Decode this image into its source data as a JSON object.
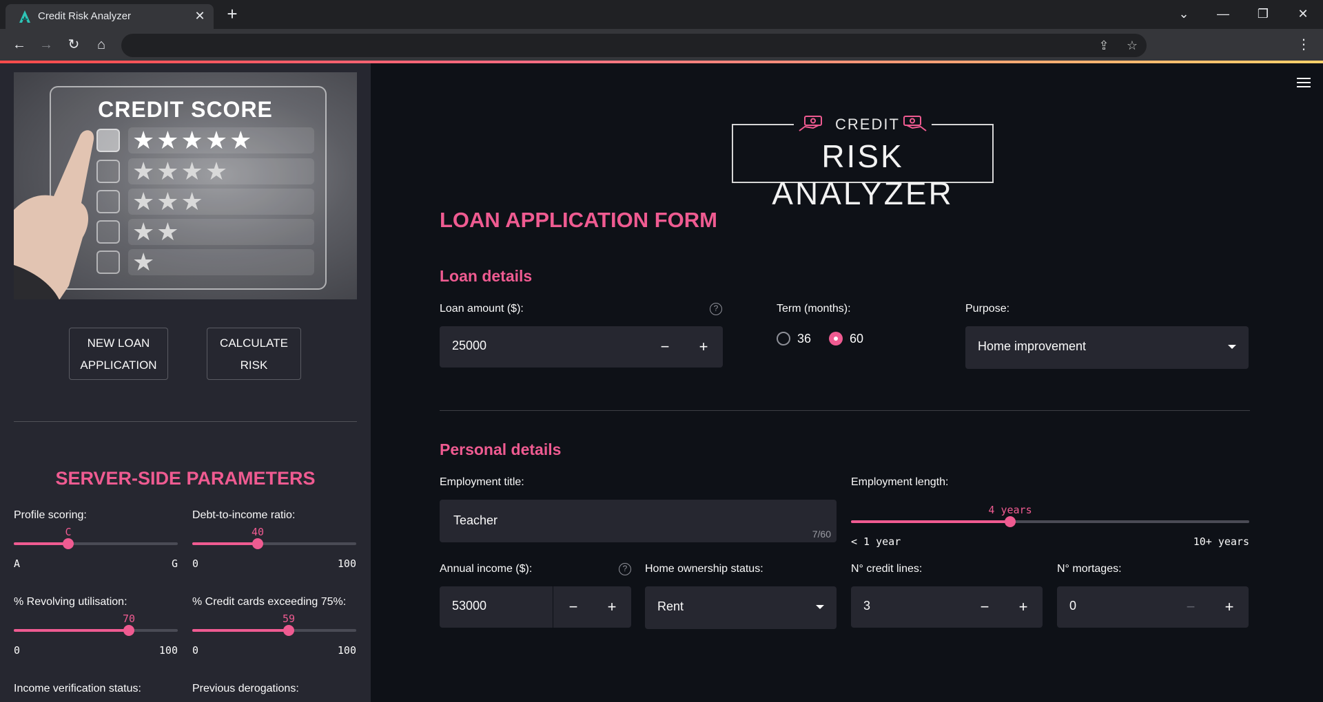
{
  "browser": {
    "tab_title": "Credit Risk Analyzer",
    "tab_close": "✕",
    "new_tab": "+",
    "window_controls": [
      "⌄",
      "—",
      "❐",
      "✕"
    ],
    "nav": {
      "back": "←",
      "forward": "→",
      "reload": "↻",
      "home": "⌂"
    },
    "omnibox_icons": [
      "share-icon",
      "star-icon"
    ],
    "menu": "⋮"
  },
  "sidebar": {
    "hero": {
      "title": "CREDIT SCORE",
      "rows": [
        "★★★★★",
        "★★★★",
        "★★★",
        "★★",
        "★"
      ]
    },
    "buttons": {
      "new_loan": [
        "NEW LOAN",
        "APPLICATION"
      ],
      "calculate": [
        "CALCULATE",
        "RISK"
      ]
    },
    "heading": "SERVER-SIDE PARAMETERS",
    "params": [
      {
        "label": "Profile scoring:",
        "value": "C",
        "min": "A",
        "max": "G",
        "fraction": 0.3333
      },
      {
        "label": "Debt-to-income ratio:",
        "value": "40",
        "min": "0",
        "max": "100",
        "fraction": 0.4
      },
      {
        "label": "% Revolving utilisation:",
        "value": "70",
        "min": "0",
        "max": "100",
        "fraction": 0.7
      },
      {
        "label": "% Credit cards exceeding 75%:",
        "value": "59",
        "min": "0",
        "max": "100",
        "fraction": 0.59
      }
    ],
    "bottom_labels": [
      "Income verification status:",
      "Previous derogations:"
    ]
  },
  "main": {
    "logo": {
      "small": "CREDIT",
      "big": "RISK ANALYZER"
    },
    "form_title": "LOAN APPLICATION FORM",
    "loan_section": "Loan details",
    "loan_amount": {
      "label": "Loan amount ($):",
      "value": "25000",
      "help": "?"
    },
    "term": {
      "label": "Term (months):",
      "options": [
        "36",
        "60"
      ],
      "selected": "60"
    },
    "purpose": {
      "label": "Purpose:",
      "value": "Home improvement"
    },
    "personal_section": "Personal details",
    "employment_title": {
      "label": "Employment title:",
      "value": "Teacher",
      "counter": "7/60"
    },
    "employment_length": {
      "label": "Employment length:",
      "value": "4 years",
      "min": "< 1 year",
      "max": "10+ years",
      "fraction": 0.4
    },
    "annual_income": {
      "label": "Annual income ($):",
      "value": "53000",
      "help": "?"
    },
    "home_ownership": {
      "label": "Home ownership status:",
      "value": "Rent"
    },
    "credit_lines": {
      "label": "N° credit lines:",
      "value": "3"
    },
    "mortgages": {
      "label": "N° mortages:",
      "value": "0"
    },
    "stepper": {
      "minus": "−",
      "plus": "+"
    }
  },
  "colors": {
    "accent": "#ef5b91",
    "bg": "#0e1117",
    "sidebar": "#262730"
  }
}
